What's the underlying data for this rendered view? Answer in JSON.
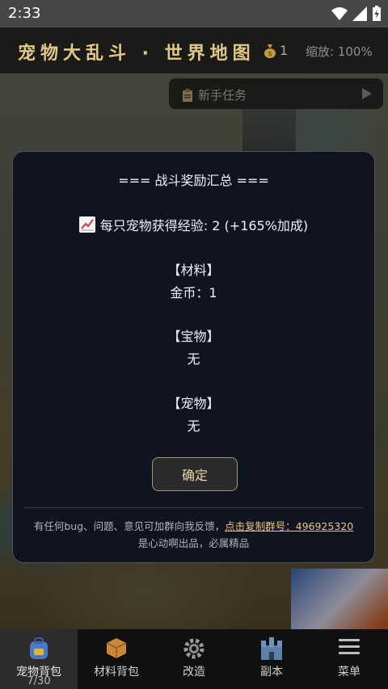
{
  "status": {
    "time": "2:33"
  },
  "header": {
    "title": "宠物大乱斗 · 世界地图",
    "coin_count": "1",
    "zoom": "缩放: 100%"
  },
  "task": {
    "label": "新手任务"
  },
  "modal": {
    "title": "=== 战斗奖励汇总 ===",
    "exp_line": "每只宠物获得经验: 2 (+165%加成)",
    "materials_header": "【材料】",
    "materials_value": "金币：1",
    "treasure_header": "【宝物】",
    "treasure_value": "无",
    "pet_header": "【宠物】",
    "pet_value": "无",
    "ok_label": "确定",
    "footer_text": "有任何bug、问题、意见可加群向我反馈，",
    "footer_link": "点击复制群号：496925320",
    "footer_line2": "是心动啊出品，必属精品"
  },
  "nav": {
    "items": [
      {
        "label": "宠物背包",
        "sub": "7/30",
        "icon": "backpack-icon"
      },
      {
        "label": "材料背包",
        "icon": "box-icon"
      },
      {
        "label": "改造",
        "icon": "gear-icon"
      },
      {
        "label": "副本",
        "icon": "castle-icon"
      },
      {
        "label": "菜单",
        "icon": "menu-icon"
      }
    ]
  }
}
